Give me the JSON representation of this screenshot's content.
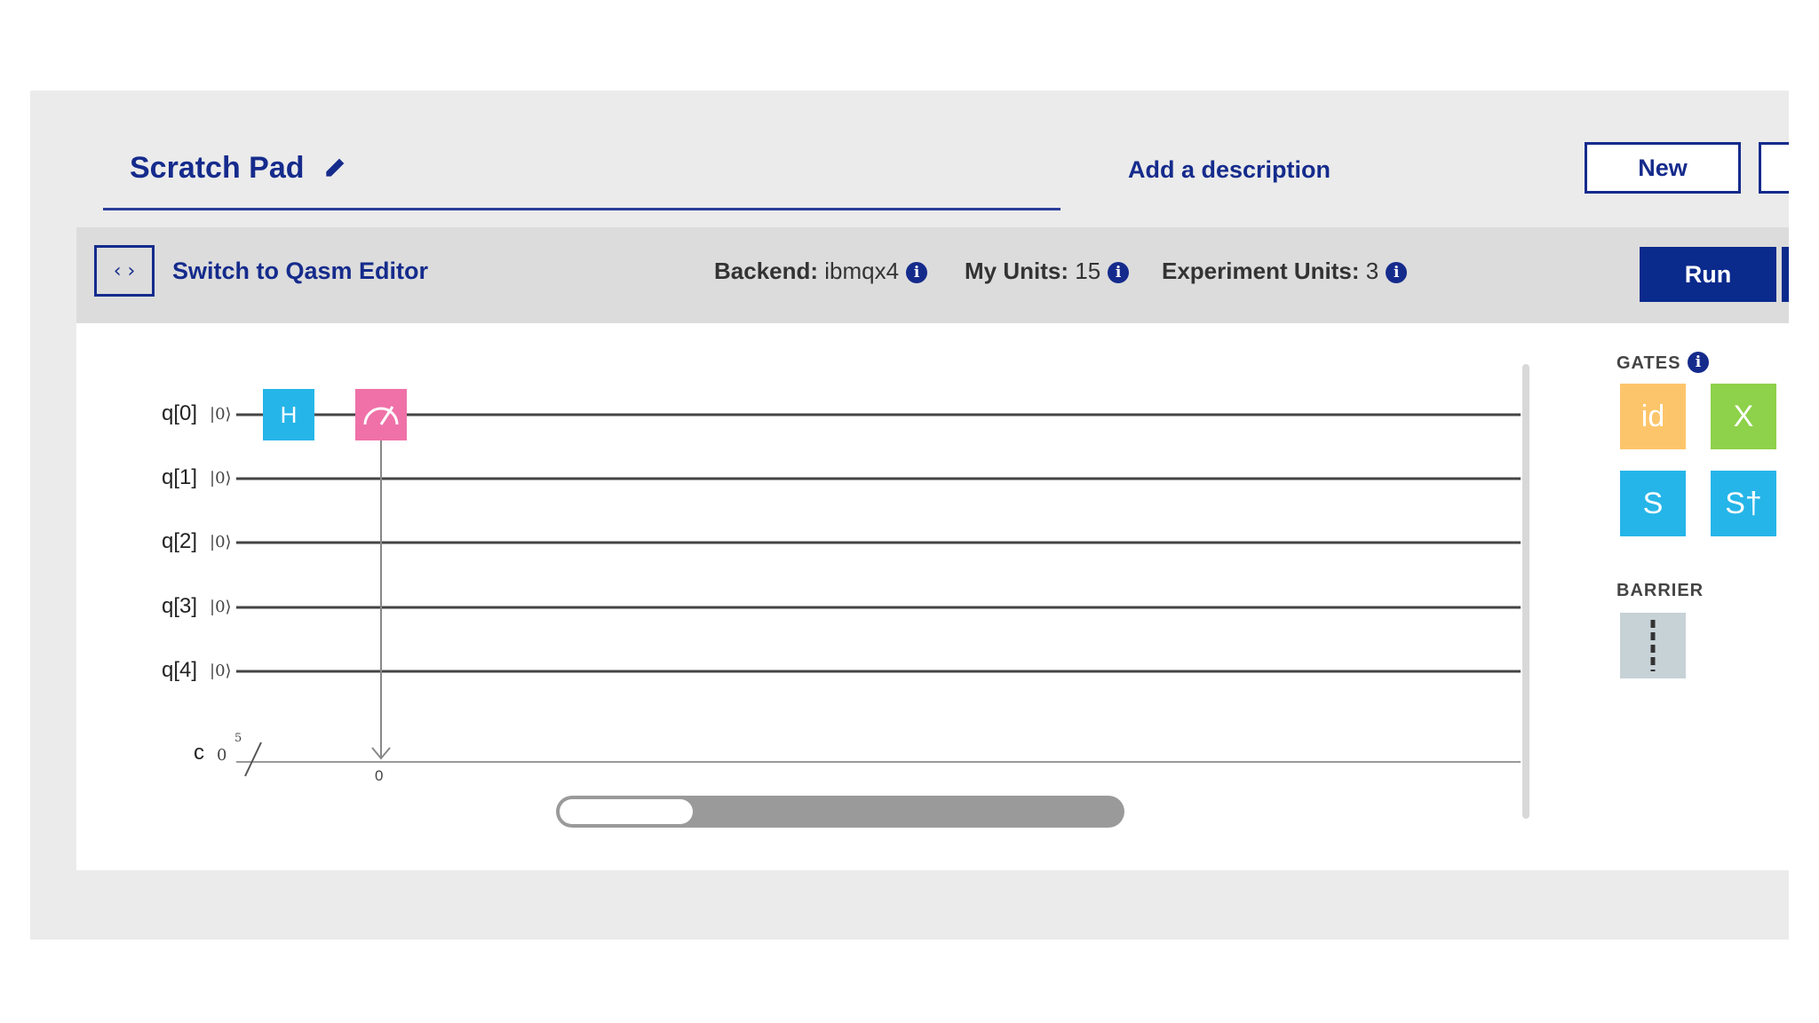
{
  "header": {
    "title": "Scratch Pad",
    "description_link": "Add a description",
    "new_button": "New"
  },
  "toolbar": {
    "switch_label": "Switch to Qasm Editor",
    "code_toggle_glyph": "‹ ›",
    "backend_label": "Backend:",
    "backend_value": "ibmqx4",
    "my_units_label": "My Units:",
    "my_units_value": "15",
    "experiment_units_label": "Experiment Units:",
    "experiment_units_value": "3",
    "run_button": "Run",
    "info_glyph": "i"
  },
  "circuit": {
    "qubits": [
      {
        "label": "q[0]",
        "init": "|0⟩"
      },
      {
        "label": "q[1]",
        "init": "|0⟩"
      },
      {
        "label": "q[2]",
        "init": "|0⟩"
      },
      {
        "label": "q[3]",
        "init": "|0⟩"
      },
      {
        "label": "q[4]",
        "init": "|0⟩"
      }
    ],
    "classical": {
      "label": "c",
      "init": "0",
      "width": "5",
      "measure_bit": "0"
    },
    "gates_on_wire": [
      {
        "qubit": "q[0]",
        "gate": "H"
      },
      {
        "qubit": "q[0]",
        "gate": "measure"
      }
    ]
  },
  "palette": {
    "gates_title": "GATES",
    "gates": [
      {
        "label": "id",
        "color": "#fdc56b"
      },
      {
        "label": "X",
        "color": "#8ed14a"
      },
      {
        "label": "S",
        "color": "#26b5e8"
      },
      {
        "label": "S†",
        "color": "#26b5e8"
      }
    ],
    "barrier_title": "BARRIER"
  },
  "colors": {
    "brand": "#152b8c",
    "hadamard": "#26b5e8",
    "measure": "#ef71a8",
    "barrier": "#c7d2d7"
  }
}
